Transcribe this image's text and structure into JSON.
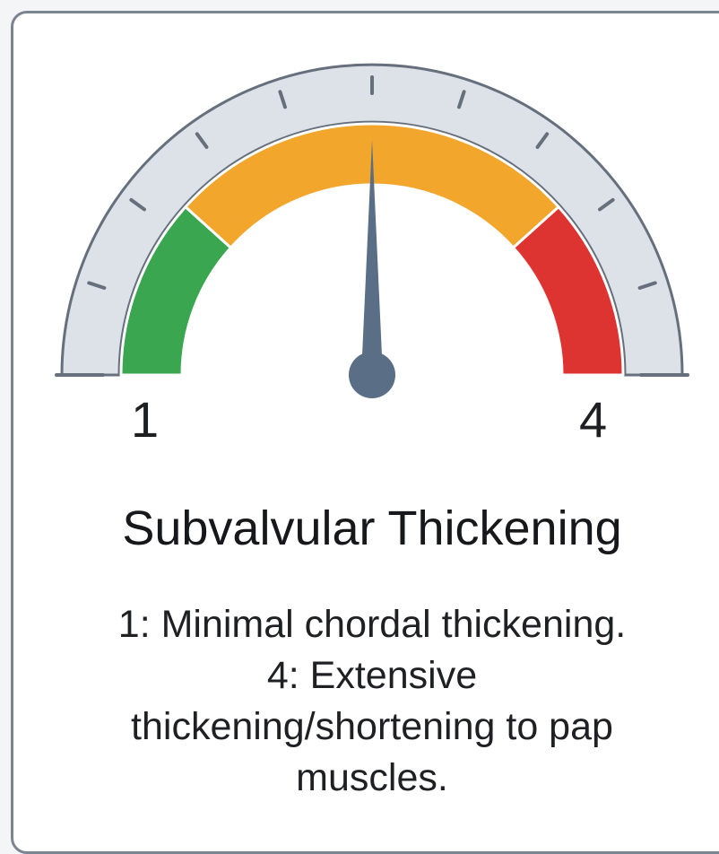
{
  "gauge": {
    "label_min": "1",
    "label_max": "4",
    "level": 0.5,
    "colors": {
      "green": "#3aa64f",
      "orange": "#f2a62c",
      "red": "#de3431",
      "track": "#dde2e9",
      "outline": "#66707c",
      "needle": "#5a6e86"
    },
    "needle_icon": "gauge-needle-icon"
  },
  "title": "Subvalvular Thickening",
  "description": {
    "line1": "1: Minimal chordal thickening.",
    "line2": "4: Extensive",
    "line3": "thickening/shortening to pap",
    "line4": "muscles."
  }
}
